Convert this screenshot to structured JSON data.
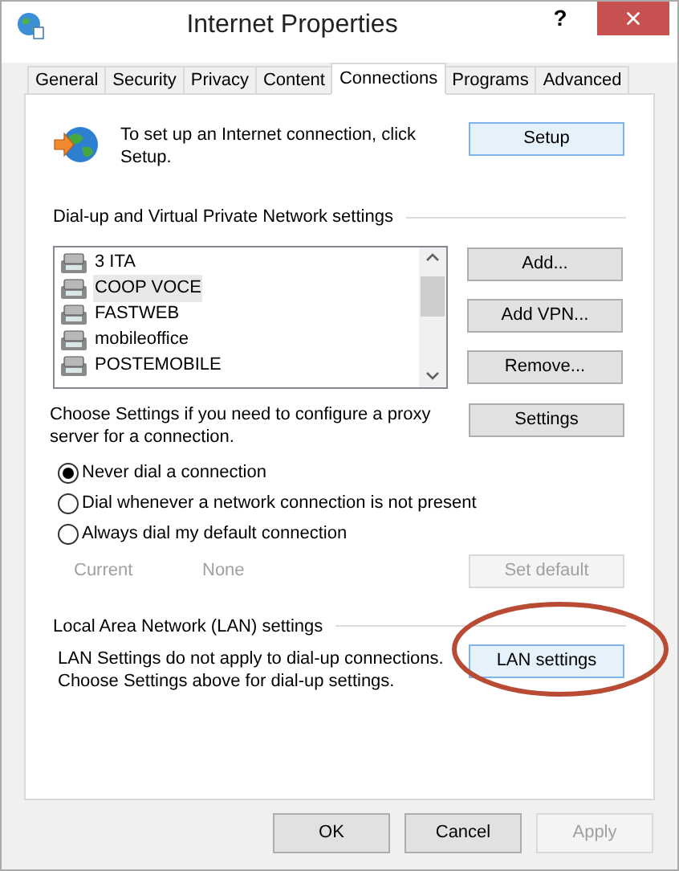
{
  "window": {
    "title": "Internet Properties",
    "help": "?"
  },
  "tabs": [
    {
      "label": "General",
      "selected": false
    },
    {
      "label": "Security",
      "selected": false
    },
    {
      "label": "Privacy",
      "selected": false
    },
    {
      "label": "Content",
      "selected": false
    },
    {
      "label": "Connections",
      "selected": true
    },
    {
      "label": "Programs",
      "selected": false
    },
    {
      "label": "Advanced",
      "selected": false
    }
  ],
  "setup": {
    "text": "To set up an Internet connection, click Setup.",
    "button": "Setup"
  },
  "dialup": {
    "heading": "Dial-up and Virtual Private Network settings",
    "connections": [
      {
        "name": "3 ITA",
        "selected": false
      },
      {
        "name": "COOP VOCE",
        "selected": true
      },
      {
        "name": "FASTWEB",
        "selected": false
      },
      {
        "name": "mobileoffice",
        "selected": false
      },
      {
        "name": "POSTEMOBILE",
        "selected": false
      }
    ],
    "buttons": [
      "Add...",
      "Add VPN...",
      "Remove..."
    ],
    "proxy_text": "Choose Settings if you need to configure a proxy server for a connection.",
    "settings_button": "Settings",
    "options": [
      {
        "label": "Never dial a connection",
        "selected": true
      },
      {
        "label": "Dial whenever a network connection is not present",
        "selected": false
      },
      {
        "label": "Always dial my default connection",
        "selected": false
      }
    ],
    "current_label": "Current",
    "current_value": "None",
    "set_default": {
      "label": "Set default",
      "disabled": true
    }
  },
  "lan": {
    "heading": "Local Area Network (LAN) settings",
    "text": "LAN Settings do not apply to dial-up connections. Choose Settings above for dial-up settings.",
    "button": {
      "label": "LAN settings",
      "highlighted": true
    }
  },
  "footer": [
    {
      "label": "OK",
      "disabled": false
    },
    {
      "label": "Cancel",
      "disabled": false
    },
    {
      "label": "Apply",
      "disabled": true
    }
  ]
}
